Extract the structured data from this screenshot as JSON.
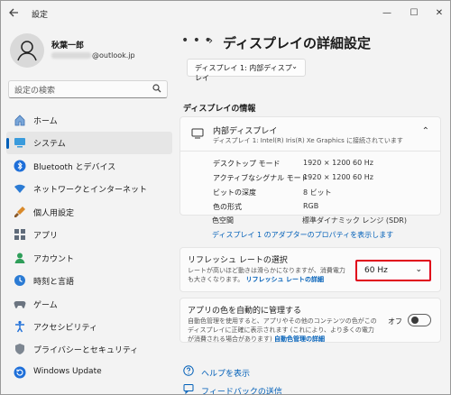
{
  "app": {
    "title": "設定",
    "back_icon": "back-arrow-icon"
  },
  "window_controls": {
    "minimize": "—",
    "maximize": "☐",
    "close": "✕"
  },
  "user": {
    "name": "秋葉一郎",
    "email_suffix": "@outlook.jp"
  },
  "search": {
    "placeholder": "設定の検索"
  },
  "sidebar": {
    "items": [
      {
        "label": "ホーム",
        "icon": "home-icon",
        "active": false
      },
      {
        "label": "システム",
        "icon": "system-display-icon",
        "active": true
      },
      {
        "label": "Bluetooth とデバイス",
        "icon": "bluetooth-icon",
        "active": false
      },
      {
        "label": "ネットワークとインターネット",
        "icon": "wifi-icon",
        "active": false
      },
      {
        "label": "個人用設定",
        "icon": "paintbrush-icon",
        "active": false
      },
      {
        "label": "アプリ",
        "icon": "apps-icon",
        "active": false
      },
      {
        "label": "アカウント",
        "icon": "account-icon",
        "active": false
      },
      {
        "label": "時刻と言語",
        "icon": "time-language-icon",
        "active": false
      },
      {
        "label": "ゲーム",
        "icon": "gamepad-icon",
        "active": false
      },
      {
        "label": "アクセシビリティ",
        "icon": "accessibility-icon",
        "active": false
      },
      {
        "label": "プライバシーとセキュリティ",
        "icon": "shield-icon",
        "active": false
      },
      {
        "label": "Windows Update",
        "icon": "update-icon",
        "active": false
      }
    ]
  },
  "header": {
    "ellipsis": "• • •",
    "chevron": "›",
    "title": "ディスプレイの詳細設定"
  },
  "main": {
    "display_select": "ディスプレイ 1: 内部ディスプレイ",
    "section_title": "ディスプレイの情報",
    "display_card": {
      "name": "内部ディスプレイ",
      "subtitle": "ディスプレイ 1: Intel(R) Iris(R) Xe Graphics に接続されています",
      "specs": [
        {
          "key": "デスクトップ モード",
          "value": "1920 × 1200 60 Hz"
        },
        {
          "key": "アクティブなシグナル モード",
          "value": "1920 × 1200 60 Hz"
        },
        {
          "key": "ビットの深度",
          "value": "8 ビット"
        },
        {
          "key": "色の形式",
          "value": "RGB"
        },
        {
          "key": "色空間",
          "value": "標準ダイナミック レンジ (SDR)"
        }
      ],
      "adapter_link": "ディスプレイ 1 のアダプターのプロパティを表示します"
    },
    "refresh": {
      "title": "リフレッシュ レートの選択",
      "desc": "レートが高いほど動きは滑らかになりますが、消費電力も大きくなります。",
      "link": "リフレッシュ レートの詳細",
      "value": "60 Hz"
    },
    "color_manage": {
      "title": "アプリの色を自動的に管理する",
      "desc": "自動色管理を使用すると、アプリやその他のコンテンツの色がこのディスプレイに正確に表示されます (これにより、より多くの電力が消費される場合があります)",
      "link": "自動色管理の詳細",
      "toggle_label": "オフ",
      "toggle_on": false
    },
    "help": {
      "get_help": "ヘルプを表示",
      "feedback": "フィードバックの送信"
    }
  }
}
